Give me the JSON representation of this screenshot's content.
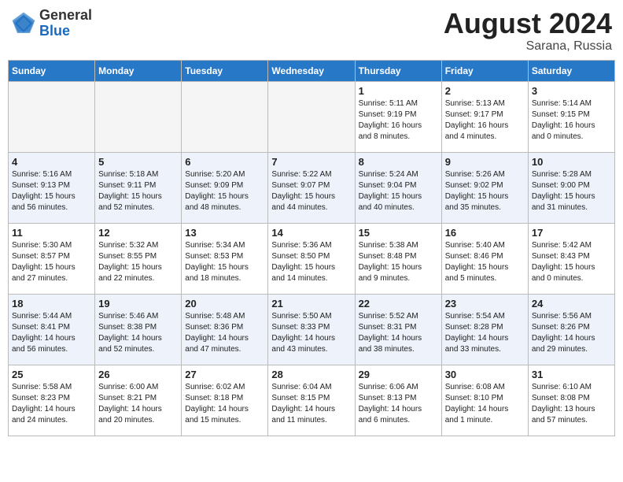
{
  "header": {
    "logo": {
      "general": "General",
      "blue": "Blue"
    },
    "month": "August 2024",
    "location": "Sarana, Russia"
  },
  "days_of_week": [
    "Sunday",
    "Monday",
    "Tuesday",
    "Wednesday",
    "Thursday",
    "Friday",
    "Saturday"
  ],
  "weeks": [
    [
      {
        "day": "",
        "info": ""
      },
      {
        "day": "",
        "info": ""
      },
      {
        "day": "",
        "info": ""
      },
      {
        "day": "",
        "info": ""
      },
      {
        "day": "1",
        "info": "Sunrise: 5:11 AM\nSunset: 9:19 PM\nDaylight: 16 hours\nand 8 minutes."
      },
      {
        "day": "2",
        "info": "Sunrise: 5:13 AM\nSunset: 9:17 PM\nDaylight: 16 hours\nand 4 minutes."
      },
      {
        "day": "3",
        "info": "Sunrise: 5:14 AM\nSunset: 9:15 PM\nDaylight: 16 hours\nand 0 minutes."
      }
    ],
    [
      {
        "day": "4",
        "info": "Sunrise: 5:16 AM\nSunset: 9:13 PM\nDaylight: 15 hours\nand 56 minutes."
      },
      {
        "day": "5",
        "info": "Sunrise: 5:18 AM\nSunset: 9:11 PM\nDaylight: 15 hours\nand 52 minutes."
      },
      {
        "day": "6",
        "info": "Sunrise: 5:20 AM\nSunset: 9:09 PM\nDaylight: 15 hours\nand 48 minutes."
      },
      {
        "day": "7",
        "info": "Sunrise: 5:22 AM\nSunset: 9:07 PM\nDaylight: 15 hours\nand 44 minutes."
      },
      {
        "day": "8",
        "info": "Sunrise: 5:24 AM\nSunset: 9:04 PM\nDaylight: 15 hours\nand 40 minutes."
      },
      {
        "day": "9",
        "info": "Sunrise: 5:26 AM\nSunset: 9:02 PM\nDaylight: 15 hours\nand 35 minutes."
      },
      {
        "day": "10",
        "info": "Sunrise: 5:28 AM\nSunset: 9:00 PM\nDaylight: 15 hours\nand 31 minutes."
      }
    ],
    [
      {
        "day": "11",
        "info": "Sunrise: 5:30 AM\nSunset: 8:57 PM\nDaylight: 15 hours\nand 27 minutes."
      },
      {
        "day": "12",
        "info": "Sunrise: 5:32 AM\nSunset: 8:55 PM\nDaylight: 15 hours\nand 22 minutes."
      },
      {
        "day": "13",
        "info": "Sunrise: 5:34 AM\nSunset: 8:53 PM\nDaylight: 15 hours\nand 18 minutes."
      },
      {
        "day": "14",
        "info": "Sunrise: 5:36 AM\nSunset: 8:50 PM\nDaylight: 15 hours\nand 14 minutes."
      },
      {
        "day": "15",
        "info": "Sunrise: 5:38 AM\nSunset: 8:48 PM\nDaylight: 15 hours\nand 9 minutes."
      },
      {
        "day": "16",
        "info": "Sunrise: 5:40 AM\nSunset: 8:46 PM\nDaylight: 15 hours\nand 5 minutes."
      },
      {
        "day": "17",
        "info": "Sunrise: 5:42 AM\nSunset: 8:43 PM\nDaylight: 15 hours\nand 0 minutes."
      }
    ],
    [
      {
        "day": "18",
        "info": "Sunrise: 5:44 AM\nSunset: 8:41 PM\nDaylight: 14 hours\nand 56 minutes."
      },
      {
        "day": "19",
        "info": "Sunrise: 5:46 AM\nSunset: 8:38 PM\nDaylight: 14 hours\nand 52 minutes."
      },
      {
        "day": "20",
        "info": "Sunrise: 5:48 AM\nSunset: 8:36 PM\nDaylight: 14 hours\nand 47 minutes."
      },
      {
        "day": "21",
        "info": "Sunrise: 5:50 AM\nSunset: 8:33 PM\nDaylight: 14 hours\nand 43 minutes."
      },
      {
        "day": "22",
        "info": "Sunrise: 5:52 AM\nSunset: 8:31 PM\nDaylight: 14 hours\nand 38 minutes."
      },
      {
        "day": "23",
        "info": "Sunrise: 5:54 AM\nSunset: 8:28 PM\nDaylight: 14 hours\nand 33 minutes."
      },
      {
        "day": "24",
        "info": "Sunrise: 5:56 AM\nSunset: 8:26 PM\nDaylight: 14 hours\nand 29 minutes."
      }
    ],
    [
      {
        "day": "25",
        "info": "Sunrise: 5:58 AM\nSunset: 8:23 PM\nDaylight: 14 hours\nand 24 minutes."
      },
      {
        "day": "26",
        "info": "Sunrise: 6:00 AM\nSunset: 8:21 PM\nDaylight: 14 hours\nand 20 minutes."
      },
      {
        "day": "27",
        "info": "Sunrise: 6:02 AM\nSunset: 8:18 PM\nDaylight: 14 hours\nand 15 minutes."
      },
      {
        "day": "28",
        "info": "Sunrise: 6:04 AM\nSunset: 8:15 PM\nDaylight: 14 hours\nand 11 minutes."
      },
      {
        "day": "29",
        "info": "Sunrise: 6:06 AM\nSunset: 8:13 PM\nDaylight: 14 hours\nand 6 minutes."
      },
      {
        "day": "30",
        "info": "Sunrise: 6:08 AM\nSunset: 8:10 PM\nDaylight: 14 hours\nand 1 minute."
      },
      {
        "day": "31",
        "info": "Sunrise: 6:10 AM\nSunset: 8:08 PM\nDaylight: 13 hours\nand 57 minutes."
      }
    ]
  ]
}
